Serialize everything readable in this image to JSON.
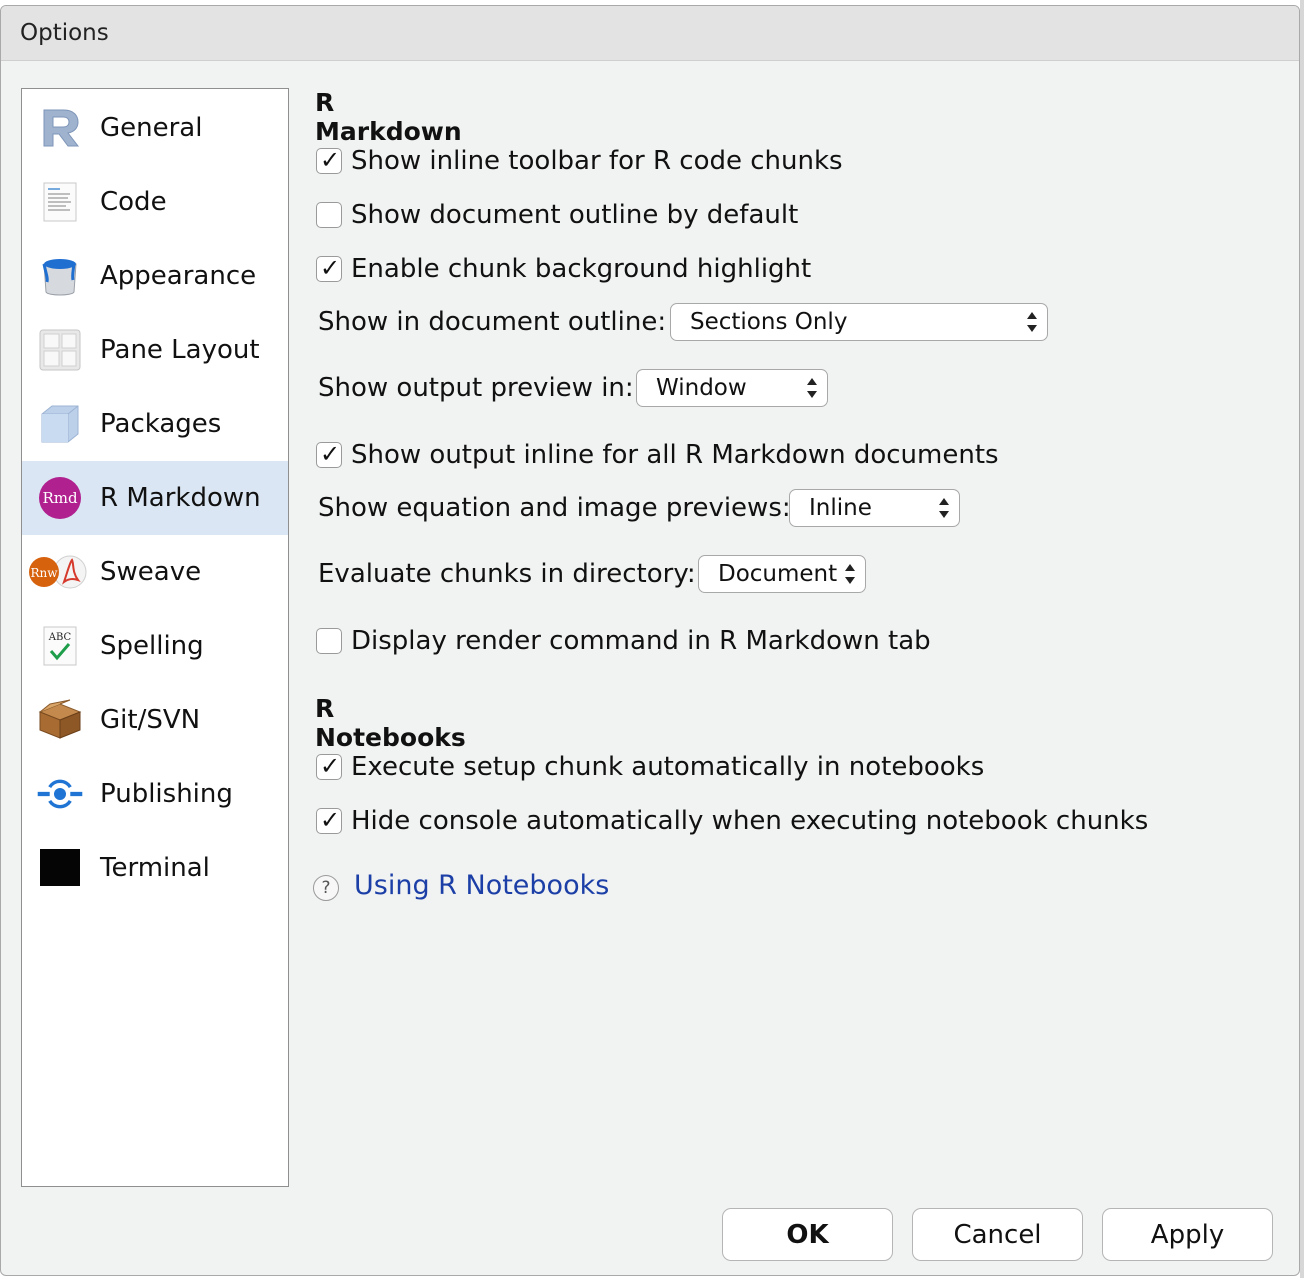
{
  "window": {
    "title": "Options"
  },
  "sidebar": {
    "items": [
      {
        "label": "General",
        "icon": "r-logo-icon"
      },
      {
        "label": "Code",
        "icon": "code-document-icon"
      },
      {
        "label": "Appearance",
        "icon": "paint-bucket-icon"
      },
      {
        "label": "Pane Layout",
        "icon": "pane-grid-icon"
      },
      {
        "label": "Packages",
        "icon": "package-box-icon"
      },
      {
        "label": "R Markdown",
        "icon": "rmd-icon",
        "icon_text": "Rmd",
        "selected": true
      },
      {
        "label": "Sweave",
        "icon": "sweave-icon",
        "icon_text": "Rnw"
      },
      {
        "label": "Spelling",
        "icon": "spelling-check-icon",
        "icon_text": "ABC"
      },
      {
        "label": "Git/SVN",
        "icon": "git-box-icon"
      },
      {
        "label": "Publishing",
        "icon": "publishing-icon"
      },
      {
        "label": "Terminal",
        "icon": "terminal-icon"
      }
    ]
  },
  "rmarkdown": {
    "heading": "R Markdown",
    "inline_toolbar": {
      "label": "Show inline toolbar for R code chunks",
      "checked": true
    },
    "doc_outline_default": {
      "label": "Show document outline by default",
      "checked": false
    },
    "chunk_bg_highlight": {
      "label": "Enable chunk background highlight",
      "checked": true
    },
    "doc_outline_show": {
      "label": "Show in document outline:",
      "value": "Sections Only"
    },
    "output_preview": {
      "label": "Show output preview in:",
      "value": "Window"
    },
    "output_inline": {
      "label": "Show output inline for all R Markdown documents",
      "checked": true
    },
    "equation_previews": {
      "label": "Show equation and image previews:",
      "value": "Inline"
    },
    "eval_directory": {
      "label": "Evaluate chunks in directory:",
      "value": "Document"
    },
    "render_command": {
      "label": "Display render command in R Markdown tab",
      "checked": false
    }
  },
  "notebooks": {
    "heading": "R Notebooks",
    "setup_chunk": {
      "label": "Execute setup chunk automatically in notebooks",
      "checked": true
    },
    "hide_console": {
      "label": "Hide console automatically when executing notebook chunks",
      "checked": true
    },
    "help_link": {
      "label": "Using R Notebooks",
      "help_glyph": "?"
    }
  },
  "buttons": {
    "ok": "OK",
    "cancel": "Cancel",
    "apply": "Apply"
  },
  "colors": {
    "selected_bg": "#dae6f3",
    "link": "#1b3fa6",
    "rmd_purple": "#b0208f"
  }
}
